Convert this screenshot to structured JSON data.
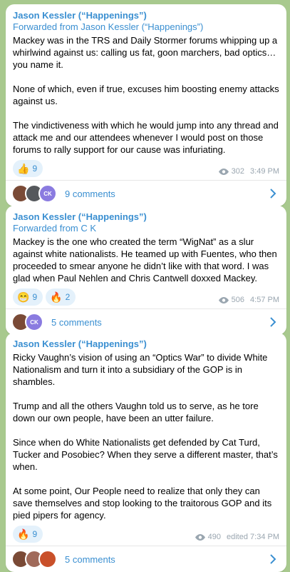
{
  "messages": [
    {
      "author": "Jason Kessler (“Happenings”)",
      "forwarded": "Forwarded from Jason Kessler (“Happenings”)",
      "paragraphs": [
        "Mackey was in the TRS and Daily Stormer forums whipping up a whirlwind against us: calling us fat, goon marchers, bad optics… you name it.",
        "None of which, even if true, excuses him boosting enemy attacks against us.",
        "The vindictiveness with which he would jump into any thread and attack me and our attendees whenever I would post on those forums to rally support for our cause was infuriating."
      ],
      "reactions": [
        {
          "emoji": "👍",
          "count": "9"
        }
      ],
      "views": "302",
      "time": "3:49 PM",
      "avatars": [
        "",
        "",
        "CK"
      ],
      "comments": "9 comments"
    },
    {
      "author": "Jason Kessler (“Happenings”)",
      "forwarded": "Forwarded from C K",
      "paragraphs": [
        "Mackey is the one who created the term “WigNat” as a slur against white nationalists. He teamed up with Fuentes, who then proceeded to smear anyone he didn’t like with that word. I was glad when Paul Nehlen and Chris Cantwell doxxed Mackey."
      ],
      "reactions": [
        {
          "emoji": "😁",
          "count": "9"
        },
        {
          "emoji": "🔥",
          "count": "2"
        }
      ],
      "views": "506",
      "time": "4:57 PM",
      "avatars": [
        "",
        "CK"
      ],
      "comments": "5 comments"
    },
    {
      "author": "Jason Kessler (“Happenings”)",
      "forwarded": "",
      "paragraphs": [
        "Ricky Vaughn’s vision of using an “Optics War” to divide White Nationalism and turn it into a subsidiary of the GOP is in shambles.",
        "Trump and all the others Vaughn told us to serve, as he tore down our own people, have been an utter failure.",
        "Since when do White Nationalists get defended by Cat Turd, Tucker and Posobiec? When they serve a different master, that’s when.",
        "At some point, Our People need to realize that only they can save themselves and stop looking to the traitorous GOP and its pied pipers for agency."
      ],
      "reactions": [
        {
          "emoji": "🔥",
          "count": "9"
        }
      ],
      "views": "490",
      "time": "edited 7:34 PM",
      "avatars": [
        "",
        "",
        ""
      ],
      "comments": "5 comments"
    }
  ],
  "colors": {
    "accent": "#3a8fd1",
    "background": "#a8c98e"
  }
}
